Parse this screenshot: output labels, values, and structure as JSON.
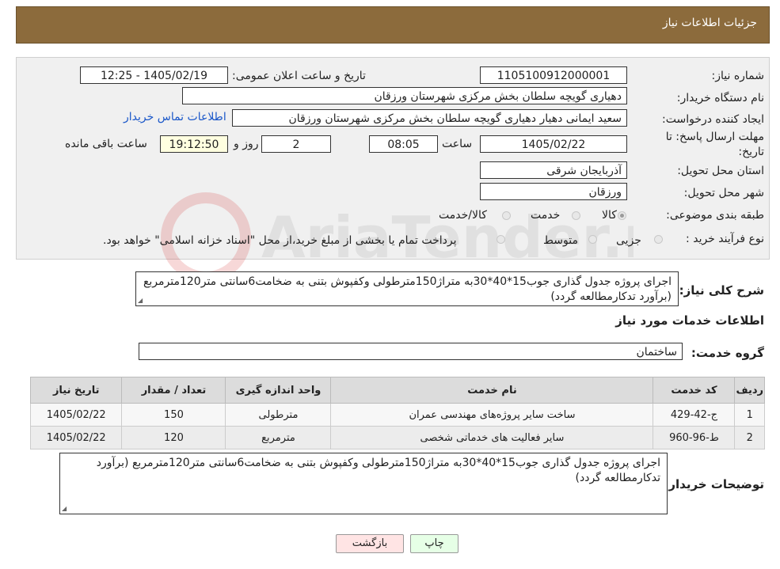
{
  "header": {
    "title": "جزئیات اطلاعات نیاز"
  },
  "fields": {
    "need_number_label": "شماره نیاز:",
    "need_number": "1105100912000001",
    "announce_label": "تاریخ و ساعت اعلان عمومی:",
    "announce_value": "1405/02/19 - 12:25",
    "buyer_org_label": "نام دستگاه خریدار:",
    "buyer_org": "دهیاری گویچه سلطان بخش مرکزی شهرستان ورزقان",
    "requester_label": "ایجاد کننده درخواست:",
    "requester": "سعید ایمانی دهیار دهیاری گویچه سلطان بخش مرکزی شهرستان ورزقان",
    "contact_link": "اطلاعات تماس خریدار",
    "deadline_label_1": "مهلت ارسال پاسخ: تا",
    "deadline_label_2": "تاریخ:",
    "deadline_date": "1405/02/22",
    "time_label": "ساعت",
    "deadline_time": "08:05",
    "days": "2",
    "days_label": "روز و",
    "remaining_time": "19:12:50",
    "remaining_label": "ساعت باقی مانده",
    "province_label": "استان محل تحویل:",
    "province": "آذربایجان شرقی",
    "city_label": "شهر محل تحویل:",
    "city": "ورزقان",
    "category_label": "طبقه بندی موضوعی:",
    "category_options": [
      "کالا",
      "خدمت",
      "کالا/خدمت"
    ],
    "category_selected": "کالا",
    "process_label": "نوع فرآیند خرید :",
    "process_options": [
      "جزیی",
      "متوسط"
    ],
    "process_note": "پرداخت تمام یا بخشی از مبلغ خرید،از محل \"اسناد خزانه اسلامی\" خواهد بود."
  },
  "summary": {
    "label": "شرح کلی نیاز:",
    "text": "اجرای پروژه جدول گذاری جوب15*40*30به متراژ150مترطولی وکفپوش بتنی به ضخامت6سانتی متر120مترمربع (برآورد تدکارمطالعه گردد)"
  },
  "services": {
    "section_title": "اطلاعات خدمات مورد نیاز",
    "group_label": "گروه خدمت:",
    "group_value": "ساختمان",
    "columns": [
      "ردیف",
      "کد خدمت",
      "نام خدمت",
      "واحد اندازه گیری",
      "تعداد / مقدار",
      "تاریخ نیاز"
    ],
    "rows": [
      [
        "1",
        "ج-42-429",
        "ساخت سایر پروژه‌های مهندسی عمران",
        "مترطولی",
        "150",
        "1405/02/22"
      ],
      [
        "2",
        "ط-96-960",
        "سایر فعالیت های خدماتی شخصی",
        "مترمربع",
        "120",
        "1405/02/22"
      ]
    ]
  },
  "buyer_notes": {
    "label": "توضیحات خریدار:",
    "text": "اجرای پروژه جدول گذاری جوب15*40*30به متراژ150مترطولی وکفپوش بتنی به ضخامت6سانتی متر120مترمربع (برآورد تدکارمطالعه گردد)"
  },
  "buttons": {
    "print": "چاپ",
    "back": "بازگشت"
  },
  "watermark": "AriaTender.neT",
  "colors": {
    "header": "#8c6b3c",
    "panel": "#f0f0f0",
    "link": "#1a57c9",
    "remaining_bg": "#ffffe0",
    "back_button": "#ffe4e4",
    "print_button": "#e6ffe6"
  }
}
